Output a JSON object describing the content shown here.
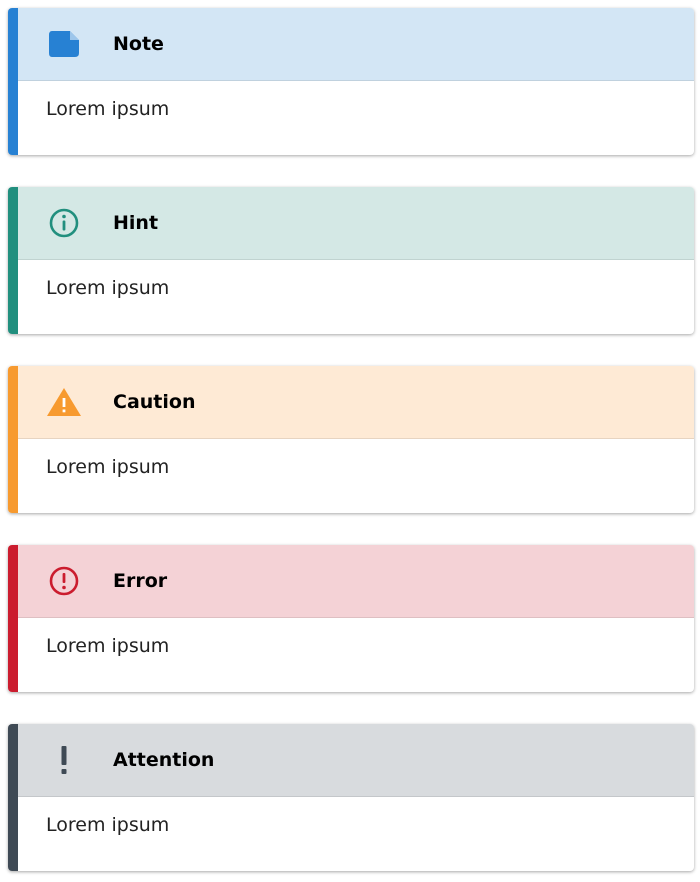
{
  "admonitions": [
    {
      "title": "Note",
      "body": "Lorem ipsum",
      "icon": "note-icon",
      "accent": "#2781d3",
      "header_bg": "#d3e6f5"
    },
    {
      "title": "Hint",
      "body": "Lorem ipsum",
      "icon": "info-circle-icon",
      "accent": "#218f7e",
      "header_bg": "#d4e8e5"
    },
    {
      "title": "Caution",
      "body": "Lorem ipsum",
      "icon": "warning-triangle-icon",
      "accent": "#f79a2f",
      "header_bg": "#feead5"
    },
    {
      "title": "Error",
      "body": "Lorem ipsum",
      "icon": "exclamation-circle-icon",
      "accent": "#cb1c2e",
      "header_bg": "#f4d2d6"
    },
    {
      "title": "Attention",
      "body": "Lorem ipsum",
      "icon": "exclamation-icon",
      "accent": "#3f4a55",
      "header_bg": "#d8dbde"
    }
  ]
}
